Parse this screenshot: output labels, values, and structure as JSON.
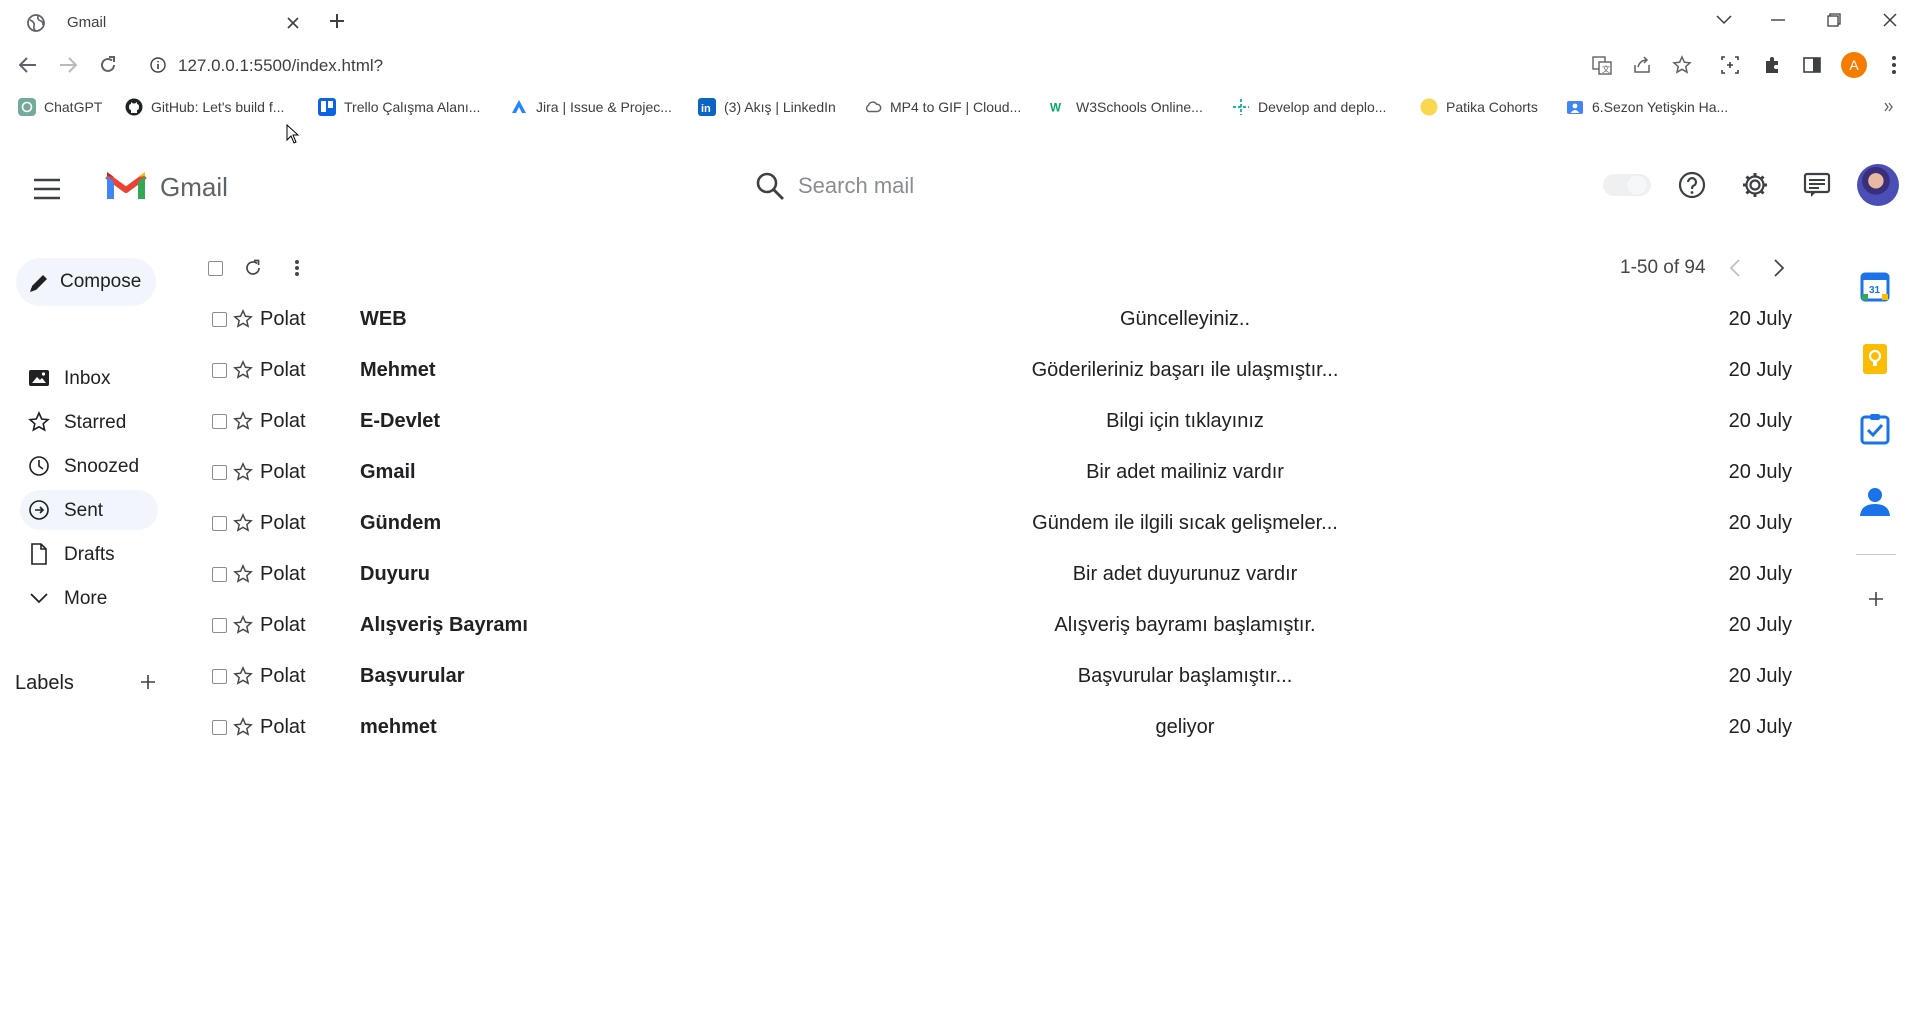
{
  "browser": {
    "tab_title": "Gmail",
    "url": "127.0.0.1:5500/index.html?",
    "profile_initial": "A",
    "profile_color": "#f57c00",
    "bookmarks": [
      {
        "label": "ChatGPT",
        "icon": "chatgpt-icon"
      },
      {
        "label": "GitHub: Let's build f...",
        "icon": "github-icon"
      },
      {
        "label": "Trello Çalışma Alanı...",
        "icon": "trello-icon"
      },
      {
        "label": "Jira | Issue & Projec...",
        "icon": "jira-icon"
      },
      {
        "label": "(3) Akış | LinkedIn",
        "icon": "linkedin-icon"
      },
      {
        "label": "MP4 to GIF | Cloud...",
        "icon": "cloud-icon"
      },
      {
        "label": "W3Schools Online...",
        "icon": "w3schools-icon"
      },
      {
        "label": "Develop and deplo...",
        "icon": "deploy-icon"
      },
      {
        "label": "Patika Cohorts",
        "icon": "patika-icon"
      },
      {
        "label": "6.Sezon Yetişkin Ha...",
        "icon": "folder-icon"
      }
    ]
  },
  "header": {
    "app_name": "Gmail",
    "search_placeholder": "Search mail"
  },
  "sidebar": {
    "compose_label": "Compose",
    "items": [
      {
        "label": "Inbox",
        "icon": "inbox-icon"
      },
      {
        "label": "Starred",
        "icon": "star-icon"
      },
      {
        "label": "Snoozed",
        "icon": "clock-icon"
      },
      {
        "label": "Sent",
        "icon": "send-icon",
        "active": true
      },
      {
        "label": "Drafts",
        "icon": "draft-icon"
      },
      {
        "label": "More",
        "icon": "chevron-down-icon"
      }
    ],
    "labels_title": "Labels"
  },
  "list": {
    "paging": "1-50 of 94",
    "rows": [
      {
        "from": "Polat",
        "subject": "WEB",
        "snippet": "Güncelleyiniz..",
        "date": "20 July"
      },
      {
        "from": "Polat",
        "subject": "Mehmet",
        "snippet": "Göderileriniz başarı ile ulaşmıştır...",
        "date": "20 July"
      },
      {
        "from": "Polat",
        "subject": "E-Devlet",
        "snippet": "Bilgi için tıklayınız",
        "date": "20 July"
      },
      {
        "from": "Polat",
        "subject": "Gmail",
        "snippet": "Bir adet mailiniz vardır",
        "date": "20 July"
      },
      {
        "from": "Polat",
        "subject": "Gündem",
        "snippet": "Gündem ile ilgili sıcak gelişmeler...",
        "date": "20 July"
      },
      {
        "from": "Polat",
        "subject": "Duyuru",
        "snippet": "Bir adet duyurunuz vardır",
        "date": "20 July"
      },
      {
        "from": "Polat",
        "subject": "Alışveriş Bayramı",
        "snippet": "Alışveriş bayramı başlamıştır.",
        "date": "20 July"
      },
      {
        "from": "Polat",
        "subject": "Başvurular",
        "snippet": "Başvurular başlamıştır...",
        "date": "20 July"
      },
      {
        "from": "Polat",
        "subject": "mehmet",
        "snippet": "geliyor",
        "date": "20 July"
      }
    ]
  },
  "side_panel": {
    "calendar_day": "31",
    "apps": [
      "calendar-icon",
      "keep-icon",
      "tasks-icon",
      "contacts-icon"
    ]
  },
  "colors": {
    "accent_blue": "#1a73e8",
    "keep_yellow": "#fbbc04",
    "active_nav_bg": "#f2f6fc"
  }
}
